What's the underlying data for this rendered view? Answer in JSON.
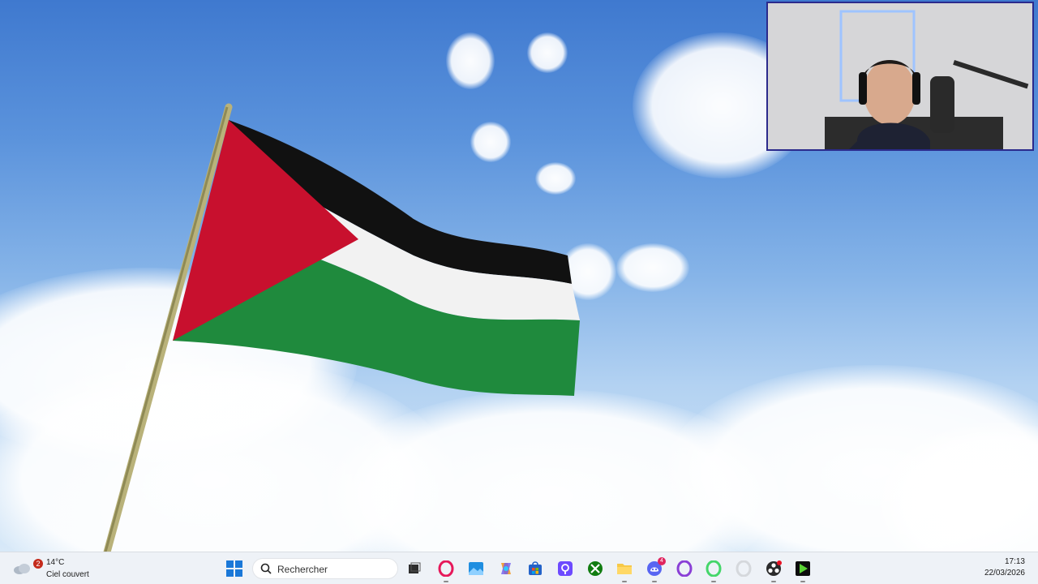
{
  "weather": {
    "badge": "2",
    "temperature": "14°C",
    "condition": "Ciel couvert"
  },
  "taskbar": {
    "search_label": "Rechercher",
    "apps": [
      {
        "name": "task-view",
        "icon": "task-view-icon"
      },
      {
        "name": "opera-gx",
        "icon": "opera-gx-icon"
      },
      {
        "name": "photos",
        "icon": "photos-icon"
      },
      {
        "name": "copilot",
        "icon": "copilot-icon"
      },
      {
        "name": "microsoft-store",
        "icon": "store-icon"
      },
      {
        "name": "proton-pass",
        "icon": "proton-pass-icon"
      },
      {
        "name": "xbox",
        "icon": "xbox-icon"
      },
      {
        "name": "file-explorer",
        "icon": "folder-icon"
      },
      {
        "name": "discord",
        "icon": "discord-icon",
        "badge": "4"
      },
      {
        "name": "opera",
        "icon": "opera-icon"
      },
      {
        "name": "opera-green",
        "icon": "opera-green-icon"
      },
      {
        "name": "opera-white",
        "icon": "opera-white-icon"
      },
      {
        "name": "obs-studio",
        "icon": "obs-icon"
      },
      {
        "name": "capcut",
        "icon": "play-icon"
      }
    ]
  },
  "clock": {
    "time": "17:13",
    "date": "22/03/2026"
  },
  "colors": {
    "flag_black": "#111111",
    "flag_white": "#f2f2f2",
    "flag_green": "#1f8a3d",
    "flag_red": "#c8102e",
    "sky_top": "#3f79cf",
    "taskbar_bg": "#eef2f7"
  }
}
